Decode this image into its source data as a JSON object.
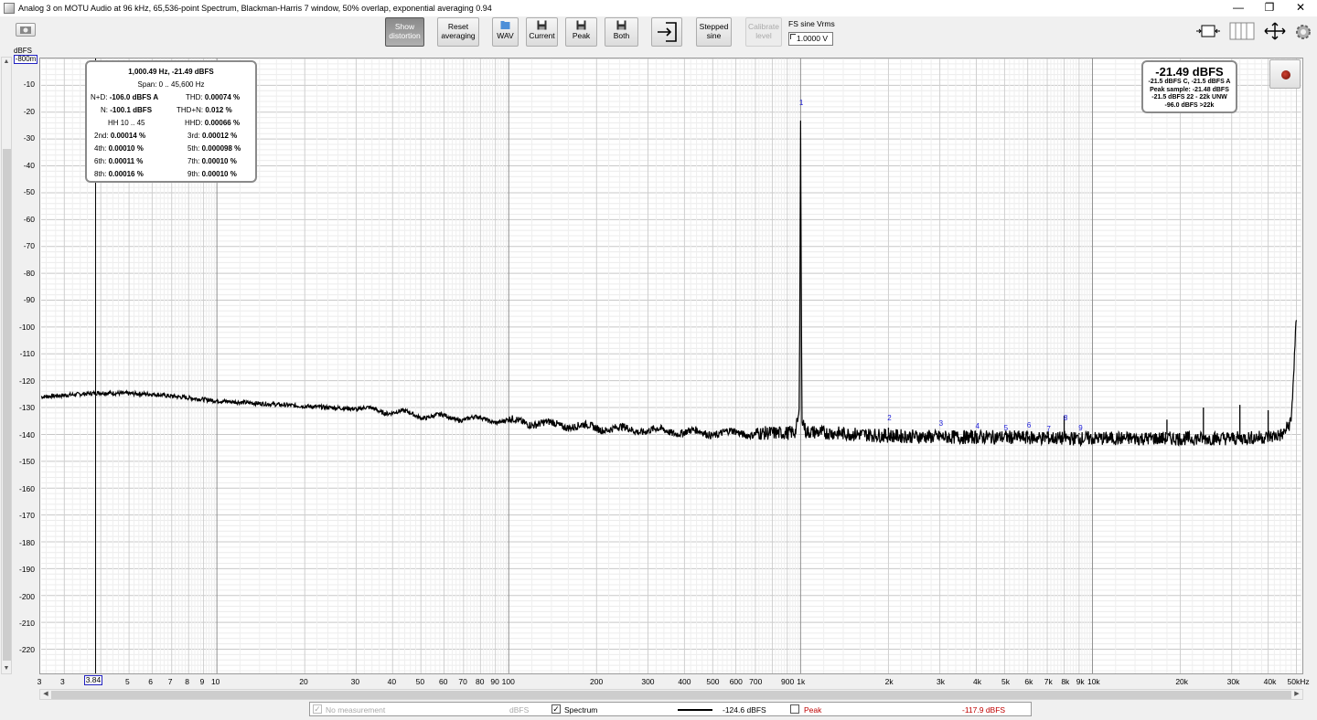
{
  "window": {
    "title": "Analog 3 on MOTU Audio at 96 kHz, 65,536-point Spectrum, Blackman-Harris 7 window, 50% overlap, exponential averaging 0.94",
    "minimize": "—",
    "restore": "❐",
    "close": "✕"
  },
  "toolbar": {
    "show_distortion": [
      "Show",
      "distortion"
    ],
    "reset_averaging": [
      "Reset",
      "averaging"
    ],
    "wav": "WAV",
    "current": "Current",
    "peak": "Peak",
    "both": "Both",
    "stepped_sine": [
      "Stepped",
      "sine"
    ],
    "calibrate_level": [
      "Calibrate",
      "level"
    ],
    "fs_label": "FS sine Vrms",
    "fs_value": "1.0000 V"
  },
  "y_axis": {
    "units": "dBFS",
    "top_marker": "-800m",
    "ticks": [
      "-10",
      "-20",
      "-30",
      "-40",
      "-50",
      "-60",
      "-70",
      "-80",
      "-90",
      "-100",
      "-110",
      "-120",
      "-130",
      "-140",
      "-150",
      "-160",
      "-170",
      "-180",
      "-190",
      "-200",
      "-210",
      "-220"
    ]
  },
  "x_axis": {
    "marker": "3.84",
    "ticks": [
      {
        "f": 3,
        "label": "3"
      },
      {
        "f": 3,
        "label": "3"
      },
      {
        "f": 5,
        "label": "5"
      },
      {
        "f": 6,
        "label": "6"
      },
      {
        "f": 7,
        "label": "7"
      },
      {
        "f": 8,
        "label": "8"
      },
      {
        "f": 9,
        "label": "9"
      },
      {
        "f": 10,
        "label": "10"
      },
      {
        "f": 20,
        "label": "20"
      },
      {
        "f": 30,
        "label": "30"
      },
      {
        "f": 40,
        "label": "40"
      },
      {
        "f": 50,
        "label": "50"
      },
      {
        "f": 60,
        "label": "60"
      },
      {
        "f": 70,
        "label": "70"
      },
      {
        "f": 80,
        "label": "80"
      },
      {
        "f": 90,
        "label": "90"
      },
      {
        "f": 100,
        "label": "100"
      },
      {
        "f": 200,
        "label": "200"
      },
      {
        "f": 300,
        "label": "300"
      },
      {
        "f": 400,
        "label": "400"
      },
      {
        "f": 500,
        "label": "500"
      },
      {
        "f": 600,
        "label": "600"
      },
      {
        "f": 700,
        "label": "700"
      },
      {
        "f": 900,
        "label": "900"
      },
      {
        "f": 1000,
        "label": "1k"
      },
      {
        "f": 2000,
        "label": "2k"
      },
      {
        "f": 3000,
        "label": "3k"
      },
      {
        "f": 4000,
        "label": "4k"
      },
      {
        "f": 5000,
        "label": "5k"
      },
      {
        "f": 6000,
        "label": "6k"
      },
      {
        "f": 7000,
        "label": "7k"
      },
      {
        "f": 8000,
        "label": "8k"
      },
      {
        "f": 9000,
        "label": "9k"
      },
      {
        "f": 10000,
        "label": "10k"
      },
      {
        "f": 20000,
        "label": "20k"
      },
      {
        "f": 30000,
        "label": "30k"
      },
      {
        "f": 40000,
        "label": "40k"
      },
      {
        "f": 50000,
        "label": "50kHz"
      }
    ]
  },
  "distortion_panel": {
    "header": "1,000.49 Hz, -21.49 dBFS",
    "span": "Span: 0 .. 45,600 Hz",
    "nd_label": "N+D:",
    "nd_value": "-106.0 dBFS A",
    "thd_label": "THD:",
    "thd_value": "0.00074 %",
    "n_label": "N:",
    "n_value": "-100.1 dBFS",
    "thdn_label": "THD+N:",
    "thdn_value": "0.012 %",
    "hh_label": "HH 10 .. 45",
    "hhd_label": "HHD:",
    "hhd_value": "0.00066 %",
    "harmonics": [
      {
        "label": "2nd:",
        "value": "0.00014 %"
      },
      {
        "label": "3rd:",
        "value": "0.00012 %"
      },
      {
        "label": "4th:",
        "value": "0.00010 %"
      },
      {
        "label": "5th:",
        "value": "0.000098 %"
      },
      {
        "label": "6th:",
        "value": "0.00011 %"
      },
      {
        "label": "7th:",
        "value": "0.00010 %"
      },
      {
        "label": "8th:",
        "value": "0.00016 %"
      },
      {
        "label": "9th:",
        "value": "0.00010 %"
      }
    ]
  },
  "level_panel": {
    "main": "-21.49 dBFS",
    "line1": "-21.5 dBFS C, -21.5 dBFS A",
    "line2": "Peak sample: -21.48 dBFS",
    "line3": "-21.5 dBFS 22 - 22k UNW",
    "line4": "-96.0 dBFS >22k"
  },
  "harmonic_markers": [
    "1",
    "2",
    "3",
    "4",
    "5",
    "6",
    "7",
    "8",
    "9"
  ],
  "legend": {
    "no_measurement": "No measurement",
    "no_measurement_units": "dBFS",
    "spectrum": "Spectrum",
    "spectrum_value": "-124.6 dBFS",
    "peak": "Peak",
    "peak_value": "-117.9 dBFS",
    "peak_color": "#c00000"
  },
  "chart_data": {
    "type": "line",
    "xscale": "log",
    "xlim": [
      2.5,
      52000
    ],
    "ylim": [
      -229,
      0
    ],
    "series": [
      {
        "name": "Spectrum",
        "color": "#000000",
        "x": [
          2.5,
          4,
          6,
          10,
          20,
          30,
          40,
          50,
          70,
          100,
          200,
          300,
          500,
          700,
          900,
          960,
          990,
          1000,
          1010,
          1040,
          2000,
          3000,
          5000,
          8000,
          10000,
          20000,
          30000,
          40000,
          45000,
          48000,
          50000
        ],
        "y": [
          -126,
          -124.5,
          -125,
          -127.5,
          -129.5,
          -130.5,
          -131.5,
          -133,
          -134,
          -135,
          -137.5,
          -138.5,
          -139.5,
          -139.5,
          -139.5,
          -139,
          -132,
          -21.5,
          -133,
          -139,
          -140.5,
          -141,
          -141,
          -141.5,
          -141.5,
          -141.5,
          -141.5,
          -141,
          -140,
          -135,
          -96.5
        ]
      }
    ],
    "spurs": [
      {
        "x": 2000,
        "y": -137.5
      },
      {
        "x": 3000,
        "y": -139
      },
      {
        "x": 4000,
        "y": -140
      },
      {
        "x": 5000,
        "y": -140
      },
      {
        "x": 6000,
        "y": -139
      },
      {
        "x": 7000,
        "y": -139
      },
      {
        "x": 8000,
        "y": -133
      },
      {
        "x": 9000,
        "y": -139.5
      },
      {
        "x": 18000,
        "y": -134.5
      },
      {
        "x": 24000,
        "y": -130
      },
      {
        "x": 32000,
        "y": -129
      },
      {
        "x": 40000,
        "y": -131
      }
    ]
  }
}
